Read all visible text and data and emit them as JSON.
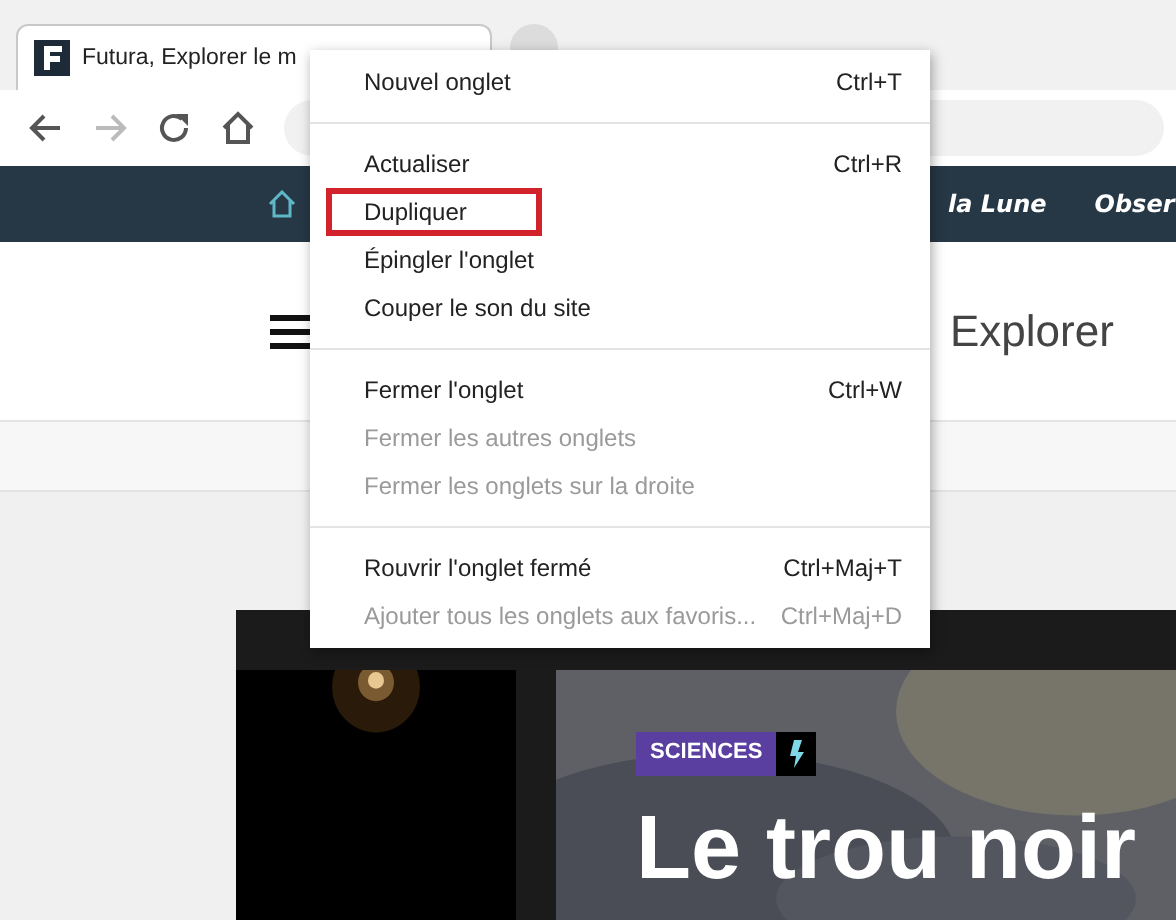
{
  "tab": {
    "title": "Futura, Explorer le m"
  },
  "toolbar": {
    "forward_disabled": true
  },
  "site_nav": {
    "items": [
      "la Lune",
      "Obser"
    ]
  },
  "site_header": {
    "title": "Explorer"
  },
  "article": {
    "badge": "SCIENCES",
    "headline": "Le trou noir"
  },
  "context_menu": {
    "sections": [
      [
        {
          "label": "Nouvel onglet",
          "shortcut": "Ctrl+T",
          "disabled": false,
          "highlighted": false
        }
      ],
      [
        {
          "label": "Actualiser",
          "shortcut": "Ctrl+R",
          "disabled": false,
          "highlighted": false
        },
        {
          "label": "Dupliquer",
          "disabled": false,
          "highlighted": true
        },
        {
          "label": "Épingler l'onglet",
          "disabled": false,
          "highlighted": false
        },
        {
          "label": "Couper le son du site",
          "disabled": false,
          "highlighted": false
        }
      ],
      [
        {
          "label": "Fermer l'onglet",
          "shortcut": "Ctrl+W",
          "disabled": false,
          "highlighted": false
        },
        {
          "label": "Fermer les autres onglets",
          "disabled": true,
          "highlighted": false
        },
        {
          "label": "Fermer les onglets sur la droite",
          "disabled": true,
          "highlighted": false
        }
      ],
      [
        {
          "label": "Rouvrir l'onglet fermé",
          "shortcut": "Ctrl+Maj+T",
          "disabled": false,
          "highlighted": false
        },
        {
          "label": "Ajouter tous les onglets aux favoris...",
          "shortcut": "Ctrl+Maj+D",
          "disabled": true,
          "highlighted": false
        }
      ]
    ]
  }
}
